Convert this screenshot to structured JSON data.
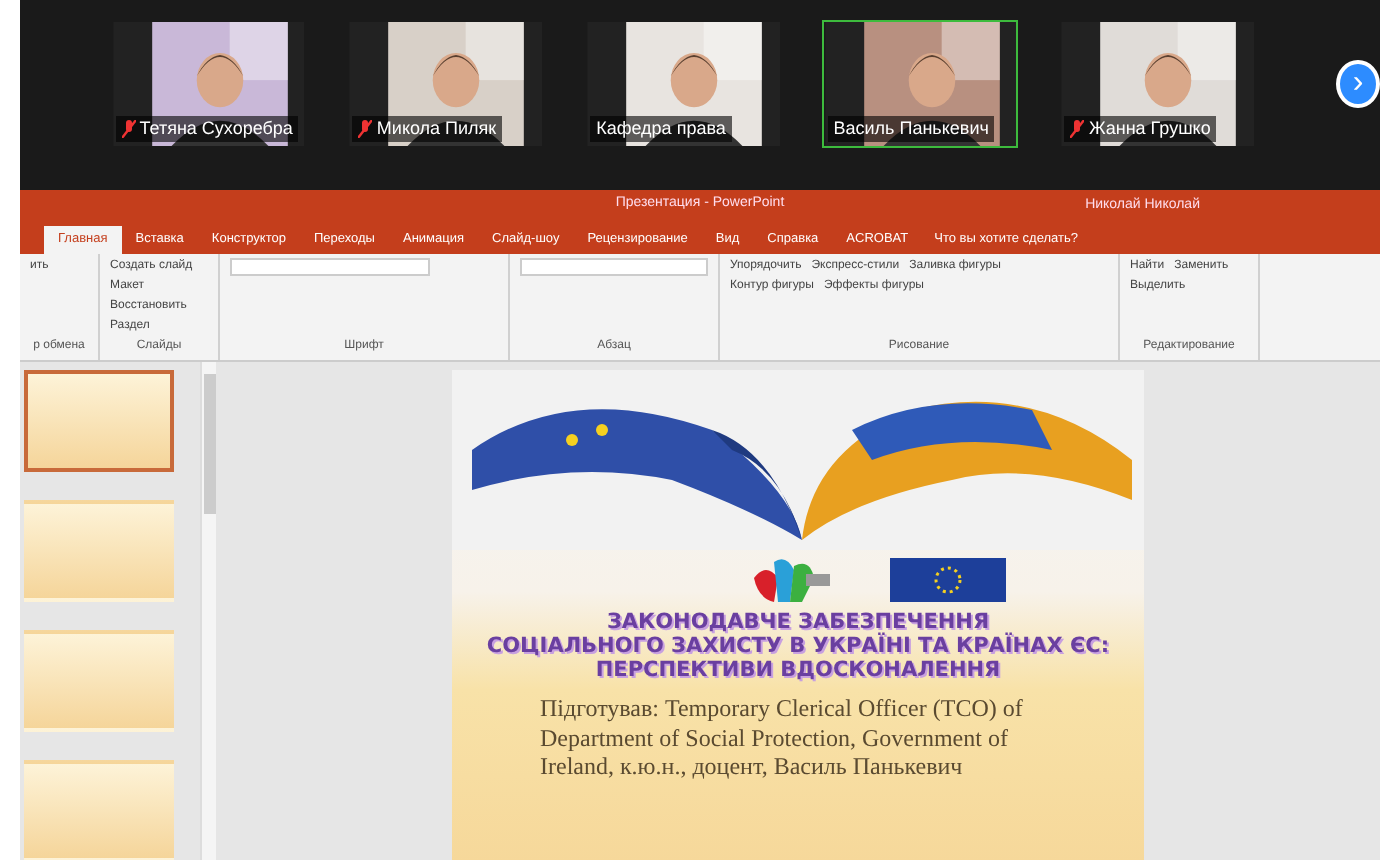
{
  "participants": [
    {
      "name": "Тетяна Сухоребра",
      "muted": true,
      "speaking": false
    },
    {
      "name": "Микола Пиляк",
      "muted": true,
      "speaking": false
    },
    {
      "name": "Кафедра права",
      "muted": false,
      "speaking": false
    },
    {
      "name": "Василь Панькевич",
      "muted": false,
      "speaking": true
    },
    {
      "name": "Жанна Грушко",
      "muted": true,
      "speaking": false
    }
  ],
  "next_button": "›",
  "ribbon": {
    "title": "Презентация - PowerPoint",
    "user": "Николай Николай",
    "tabs": [
      {
        "label": "Главная",
        "selected": true
      },
      {
        "label": "Вставка",
        "selected": false
      },
      {
        "label": "Конструктор",
        "selected": false
      },
      {
        "label": "Переходы",
        "selected": false
      },
      {
        "label": "Анимация",
        "selected": false
      },
      {
        "label": "Слайд-шоу",
        "selected": false
      },
      {
        "label": "Рецензирование",
        "selected": false
      },
      {
        "label": "Вид",
        "selected": false
      },
      {
        "label": "Справка",
        "selected": false
      },
      {
        "label": "ACROBAT",
        "selected": false
      }
    ],
    "tell_me": "Что вы хотите сделать?",
    "groups": [
      {
        "label": "р обмена",
        "items": [
          "ить"
        ]
      },
      {
        "label": "Слайды",
        "items": [
          "Создать слайд",
          "Макет",
          "Восстановить",
          "Раздел"
        ]
      },
      {
        "label": "Шрифт"
      },
      {
        "label": "Абзац"
      },
      {
        "label": "Рисование",
        "items": [
          "Упорядочить",
          "Экспресс-стили",
          "Заливка фигуры",
          "Контур фигуры",
          "Эффекты фигуры"
        ]
      },
      {
        "label": "Редактирование",
        "items": [
          "Найти",
          "Заменить",
          "Выделить"
        ]
      }
    ]
  },
  "thumbnails": [
    {
      "selected": true
    },
    {
      "selected": false
    },
    {
      "selected": false
    },
    {
      "selected": false
    }
  ],
  "slide": {
    "title": [
      "ЗАКОНОДАВЧЕ ЗАБЕЗПЕЧЕННЯ",
      "СОЦІАЛЬНОГО ЗАХИСТУ В УКРАЇНІ ТА КРАЇНАХ ЄС:",
      "ПЕРСПЕКТИВИ ВДОСКОНАЛЕННЯ"
    ],
    "body": "Підготував: Temporary Clerical Officer (TCO) of Department of Social Protection, Government of Ireland, к.ю.н., доцент, Василь Панькевич"
  }
}
